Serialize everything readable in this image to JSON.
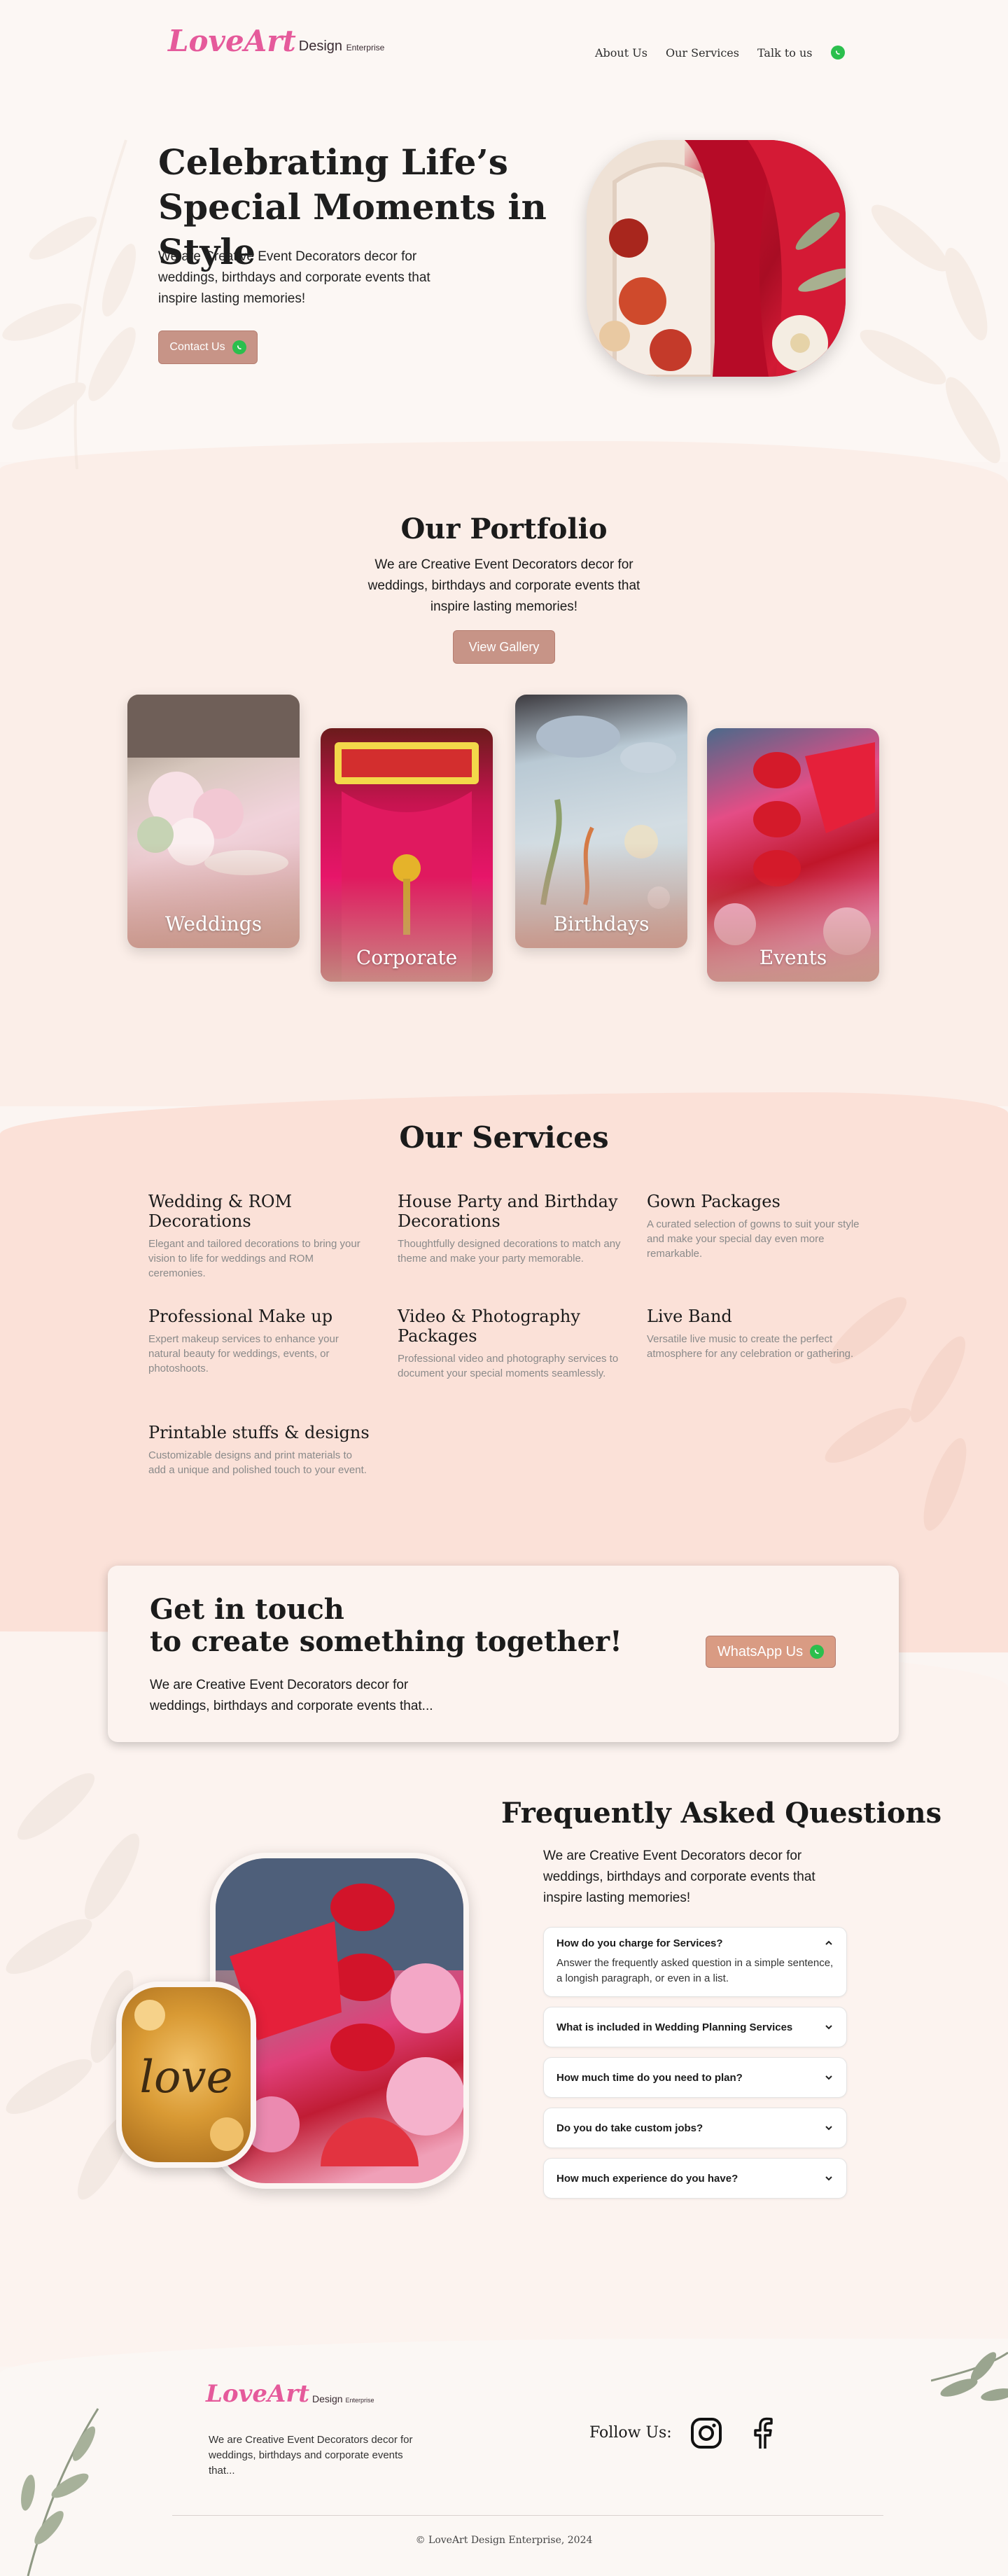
{
  "brand": {
    "logo_script": "LoveArt",
    "logo_sub": "Design",
    "logo_sub_small": "Enterprise"
  },
  "nav": {
    "items": [
      "About Us",
      "Our Services",
      "Talk to us"
    ]
  },
  "hero": {
    "title_line1": "Celebrating Life’s",
    "title_line2": "Special Moments in Style",
    "subtitle": "We are Creative Event Decorators decor for weddings, birthdays and corporate events that inspire lasting memories!",
    "cta_label": "Contact Us"
  },
  "portfolio": {
    "title": "Our Portfolio",
    "subtitle": "We are Creative Event Decorators decor for weddings, birthdays and corporate events that inspire lasting memories!",
    "button_label": "View Gallery",
    "cards": [
      {
        "label": "Weddings"
      },
      {
        "label": "Corporate"
      },
      {
        "label": "Birthdays"
      },
      {
        "label": "Events"
      }
    ]
  },
  "services": {
    "title": "Our Services",
    "items": [
      {
        "title": "Wedding & ROM Decorations",
        "desc": "Elegant and tailored decorations to bring your vision to life for weddings and ROM ceremonies."
      },
      {
        "title": "House Party and Birthday Decorations",
        "desc": "Thoughtfully designed decorations to match any theme and make your party memorable."
      },
      {
        "title": "Gown Packages",
        "desc": "A curated selection of gowns to suit your style and make your special day even more remarkable."
      },
      {
        "title": "Professional Make up",
        "desc": "Expert makeup services to enhance your natural beauty for weddings, events, or photoshoots."
      },
      {
        "title": "Video & Photography Packages",
        "desc": "Professional video and photography services to document your special moments seamlessly."
      },
      {
        "title": "Live Band",
        "desc": "Versatile live music to create the perfect atmosphere for any celebration or gathering."
      },
      {
        "title": "Printable stuffs & designs",
        "desc": "Customizable designs and print materials to add a unique and polished touch to your event."
      }
    ]
  },
  "cta": {
    "title_line1": "Get in touch",
    "title_line2": "to create something together!",
    "subtitle": "We are Creative Event Decorators decor for weddings, birthdays and corporate events that...",
    "button_label": "WhatsApp Us"
  },
  "faq": {
    "title": "Frequently Asked Questions",
    "subtitle": "We are Creative Event Decorators decor for weddings, birthdays and corporate events that inspire lasting memories!",
    "items": [
      {
        "q": "How do you charge for Services?",
        "a": "Answer the frequently asked question in a simple sentence, a longish paragraph, or even in a list."
      },
      {
        "q": "What is included in Wedding Planning Services"
      },
      {
        "q": "How much time do you need to plan?"
      },
      {
        "q": "Do you do take custom jobs?"
      },
      {
        "q": "How much experience do you have?"
      }
    ]
  },
  "footer": {
    "subtitle": "We are Creative Event Decorators decor for weddings, birthdays and corporate events that...",
    "follow_label": "Follow Us:",
    "copyright": "© LoveArt Design Enterprise, 2024"
  },
  "colors": {
    "accent": "#c79487",
    "whatsapp": "#2bbf4d",
    "logo_pink": "#e55a9b"
  }
}
